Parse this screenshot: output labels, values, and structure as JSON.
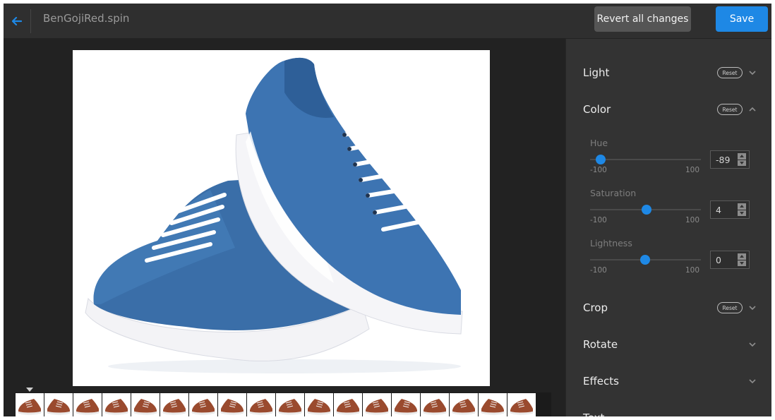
{
  "header": {
    "file_title": "BenGojiRed.spin",
    "revert_label": "Revert all changes",
    "save_label": "Save"
  },
  "colors": {
    "accent": "#1e88e5",
    "panel_bg": "#333333",
    "header_bg": "#2f2f2f",
    "canvas_bg": "#222222"
  },
  "panel": {
    "sections": {
      "light": {
        "label": "Light",
        "reset": "Reset",
        "expanded": false
      },
      "color": {
        "label": "Color",
        "reset": "Reset",
        "expanded": true
      },
      "crop": {
        "label": "Crop",
        "reset": "Reset",
        "expanded": false
      },
      "rotate": {
        "label": "Rotate",
        "expanded": false
      },
      "effects": {
        "label": "Effects",
        "expanded": false
      },
      "text": {
        "label": "Text",
        "expanded": false
      }
    },
    "sliders": {
      "hue": {
        "label": "Hue",
        "min": "-100",
        "max": "100",
        "value": "-89"
      },
      "saturation": {
        "label": "Saturation",
        "min": "-100",
        "max": "100",
        "value": "4"
      },
      "lightness": {
        "label": "Lightness",
        "min": "-100",
        "max": "100",
        "value": "0"
      }
    }
  },
  "filmstrip": {
    "thumbnail_count": 18
  }
}
